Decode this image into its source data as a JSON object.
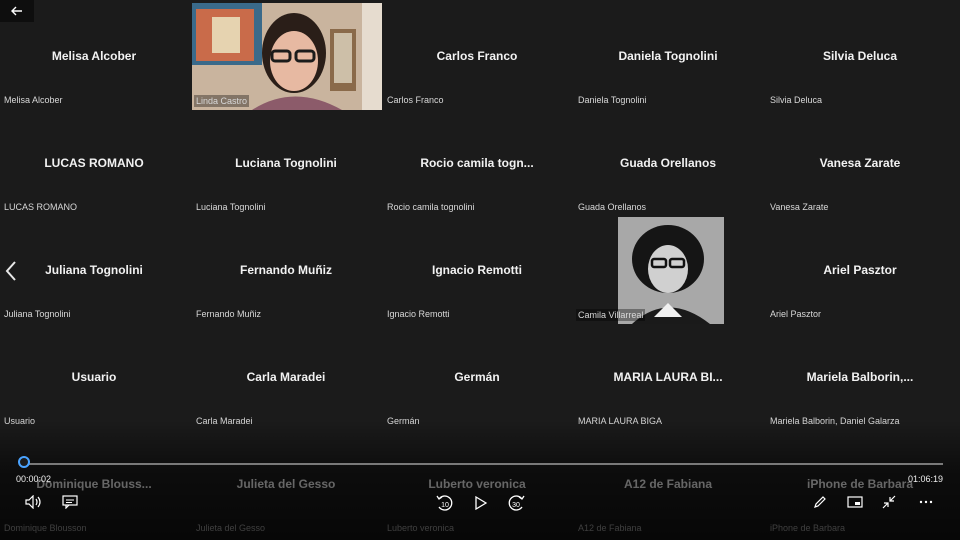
{
  "tiles": [
    {
      "big": "Melisa Alcober",
      "small": "Melisa Alcober"
    },
    {
      "big": "",
      "small": "Linda Castro"
    },
    {
      "big": "Carlos Franco",
      "small": "Carlos Franco"
    },
    {
      "big": "Daniela Tognolini",
      "small": "Daniela Tognolini"
    },
    {
      "big": "Silvia Deluca",
      "small": "Silvia Deluca"
    },
    {
      "big": "LUCAS ROMANO",
      "small": "LUCAS ROMANO"
    },
    {
      "big": "Luciana Tognolini",
      "small": "Luciana Tognolini"
    },
    {
      "big": "Rocio camila  togn...",
      "small": "Rocio camila tognolini"
    },
    {
      "big": "Guada Orellanos",
      "small": "Guada Orellanos"
    },
    {
      "big": "Vanesa Zarate",
      "small": "Vanesa Zarate"
    },
    {
      "big": "Juliana Tognolini",
      "small": "Juliana Tognolini"
    },
    {
      "big": "Fernando Muñiz",
      "small": "Fernando Muñiz"
    },
    {
      "big": "Ignacio Remotti",
      "small": "Ignacio Remotti"
    },
    {
      "big": "",
      "small": "Camila Villarreal"
    },
    {
      "big": "Ariel Pasztor",
      "small": "Ariel Pasztor"
    },
    {
      "big": "Usuario",
      "small": "Usuario"
    },
    {
      "big": "Carla Maradei",
      "small": "Carla Maradei"
    },
    {
      "big": "Germán",
      "small": "Germán"
    },
    {
      "big": "MARIA  LAURA  BI...",
      "small": "MARIA LAURA BIGA"
    },
    {
      "big": "Mariela  Balborin,...",
      "small": "Mariela Balborin, Daniel Galarza"
    },
    {
      "big": "Dominique  Blouss...",
      "small": "Dominique Blousson"
    },
    {
      "big": "Julieta del Gesso",
      "small": "Julieta del Gesso"
    },
    {
      "big": "Luberto veronica",
      "small": "Luberto veronica"
    },
    {
      "big": "A12 de Fabiana",
      "small": "A12 de Fabiana"
    },
    {
      "big": "iPhone de Barbara",
      "small": "iPhone de Barbara"
    }
  ],
  "player": {
    "elapsed": "00:00:02",
    "total": "01:06:19",
    "progress": 0.0005,
    "skip_back_label": "10",
    "skip_forward_label": "30"
  },
  "colors": {
    "accent": "#4aa3ff",
    "background": "#1b1b1b"
  }
}
